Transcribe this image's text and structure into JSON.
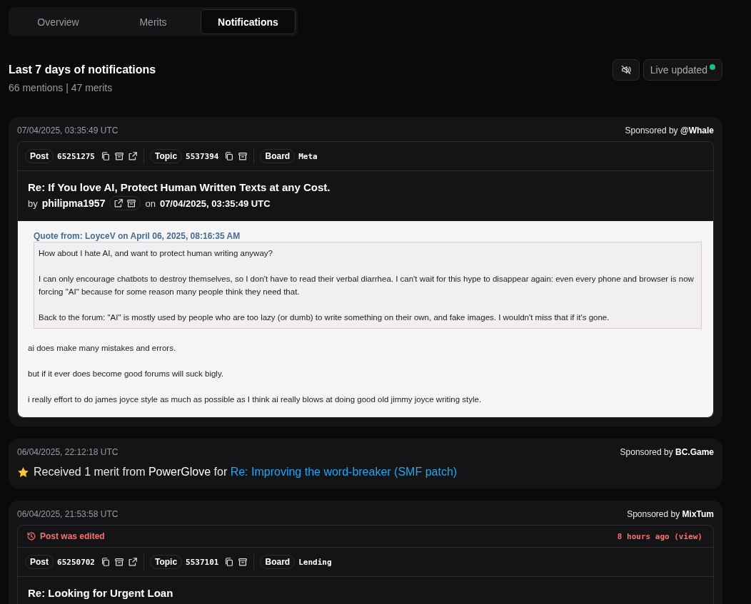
{
  "tabs": [
    {
      "label": "Overview",
      "selected": false
    },
    {
      "label": "Merits",
      "selected": false
    },
    {
      "label": "Notifications",
      "selected": true
    }
  ],
  "header": {
    "title": "Last 7 days of notifications",
    "subtitle": "66 mentions | 47 merits",
    "muted": true,
    "live": {
      "label": "Live updated",
      "on": true
    }
  },
  "notifications": [
    {
      "kind": "post",
      "time": "07/04/2025, 03:35:49 UTC",
      "sponsor": "Sponsored by **@Whale**",
      "meta": [
        {
          "kind": "post",
          "tag": "Post",
          "value": "65251275"
        },
        {
          "kind": "topic",
          "tag": "Topic",
          "value": "5537394"
        },
        {
          "kind": "board",
          "tag": "Board",
          "value": "Meta"
        }
      ],
      "title": "Re: If You love AI, Protect Human Written Texts at any Cost.",
      "by": "by",
      "author": "philipma1957",
      "on": "on",
      "date": "07/04/2025, 03:35:49 UTC",
      "quote": {
        "header": "Quote from: LoyceV on April 06, 2025, 08:16:35 AM",
        "paragraphs": [
          "How about I hate AI, and want to protect human writing anyway?",
          "I can only encourage chatbots to destroy themselves, so I don't have to read their verbal diarrhea. I can't wait for this hype to disappear again: even every phone and browser is now forcing \"AI\" because for some reason many people think they need that.",
          "Back to the forum: \"AI\" is mostly used by people who are too lazy (or dumb) to write something on their own, and fake images. I wouldn't miss that if it's gone."
        ]
      },
      "paragraphs": [
        "ai does make many mistakes and errors.",
        "but if it ever does become good forums will suck bigly.",
        "i really effort to do james joyce style as much as possible as I think ai really blows at doing good old jimmy joyce writing style."
      ]
    },
    {
      "kind": "merit",
      "time": "06/04/2025, 22:12:18 UTC",
      "sponsor": "Sponsored by **BC.Game**",
      "text": "Received 1 merit from **PowerGlove** for",
      "link": "Re: Improving the word-breaker (SMF patch)"
    },
    {
      "kind": "post",
      "time": "06/04/2025, 21:53:58 UTC",
      "sponsor": "Sponsored by **MixTum**",
      "edited": {
        "label": "Post was edited",
        "when": "8 hours ago (view)"
      },
      "meta": [
        {
          "kind": "post",
          "tag": "Post",
          "value": "65250702"
        },
        {
          "kind": "topic",
          "tag": "Topic",
          "value": "5537101"
        },
        {
          "kind": "board",
          "tag": "Board",
          "value": "Lending"
        }
      ],
      "title": "Re: Looking for Urgent Loan"
    }
  ]
}
